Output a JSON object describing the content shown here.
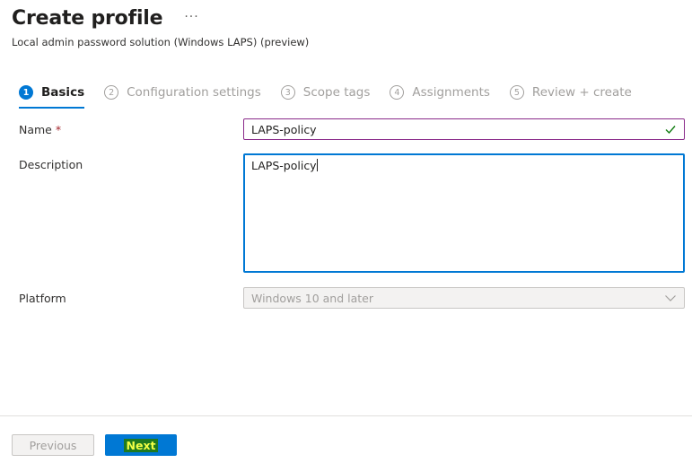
{
  "header": {
    "title": "Create profile",
    "more_label": "···",
    "subtitle": "Local admin password solution (Windows LAPS) (preview)"
  },
  "steps": [
    {
      "number": "1",
      "label": "Basics",
      "active": true
    },
    {
      "number": "2",
      "label": "Configuration settings",
      "active": false
    },
    {
      "number": "3",
      "label": "Scope tags",
      "active": false
    },
    {
      "number": "4",
      "label": "Assignments",
      "active": false
    },
    {
      "number": "5",
      "label": "Review + create",
      "active": false
    }
  ],
  "form": {
    "name_label": "Name",
    "required_mark": "*",
    "name_value": "LAPS-policy",
    "description_label": "Description",
    "description_value": "LAPS-policy",
    "platform_label": "Platform",
    "platform_value": "Windows 10 and later"
  },
  "footer": {
    "previous_label": "Previous",
    "next_label": "Next"
  },
  "colors": {
    "accent": "#0078d4",
    "valid": "#107c10",
    "required": "#a4262c"
  },
  "icons": {
    "valid": "checkmark-icon",
    "dropdown": "chevron-down-icon"
  }
}
